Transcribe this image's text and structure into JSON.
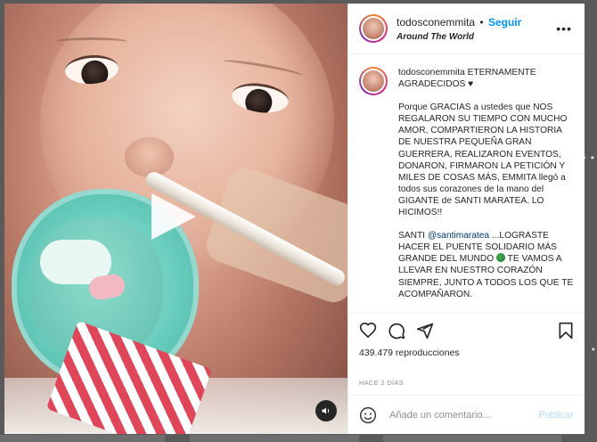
{
  "post": {
    "username": "todosconemmita",
    "follow_label": "Seguir",
    "separator": "•",
    "location": "Around The World",
    "caption_title": "ETERNAMENTE AGRADECIDOS ♥",
    "caption_paragraph1": "Porque GRACIAS a ustedes que NOS REGALARON SU TIEMPO CON MUCHO AMOR, COMPARTIERON LA HISTORIA DE NUESTRA PEQUEÑA GRAN GUERRERA, REALIZARON EVENTOS, DONARON, FIRMARON LA PETICIÓN Y MILES DE COSAS MÁS, EMMITA llegó a todos sus corazones de la mano del GIGANTE de SANTI MARATEA. LO HICIMOS!!",
    "caption_p2_prefix": "SANTI ",
    "caption_mention": "@santimaratea",
    "caption_p2_mid": " ...LOGRASTE HACER EL PUENTE SOLIDARIO MÁS GRANDE DEL MUNDO ",
    "caption_p2_suffix": " TE VAMOS A LLEVAR EN NUESTRO CORAZÓN SIEMPRE, JUNTO A TODOS LOS QUE TE ACOMPAÑARON.",
    "views": "439.479 reproducciones",
    "time_ago": "HACE 2 DÍAS",
    "comment_placeholder": "Añade un comentario...",
    "publish_label": "Publicar"
  },
  "icons": [
    "heart-icon",
    "comment-icon",
    "share-icon",
    "bookmark-icon",
    "emoji-icon",
    "more-icon",
    "play-icon",
    "mute-icon",
    "globe-emoji"
  ],
  "colors": {
    "link": "#0095f6",
    "publish_disabled": "#b2dffc",
    "text": "#262626",
    "muted": "#8e8e8e"
  }
}
